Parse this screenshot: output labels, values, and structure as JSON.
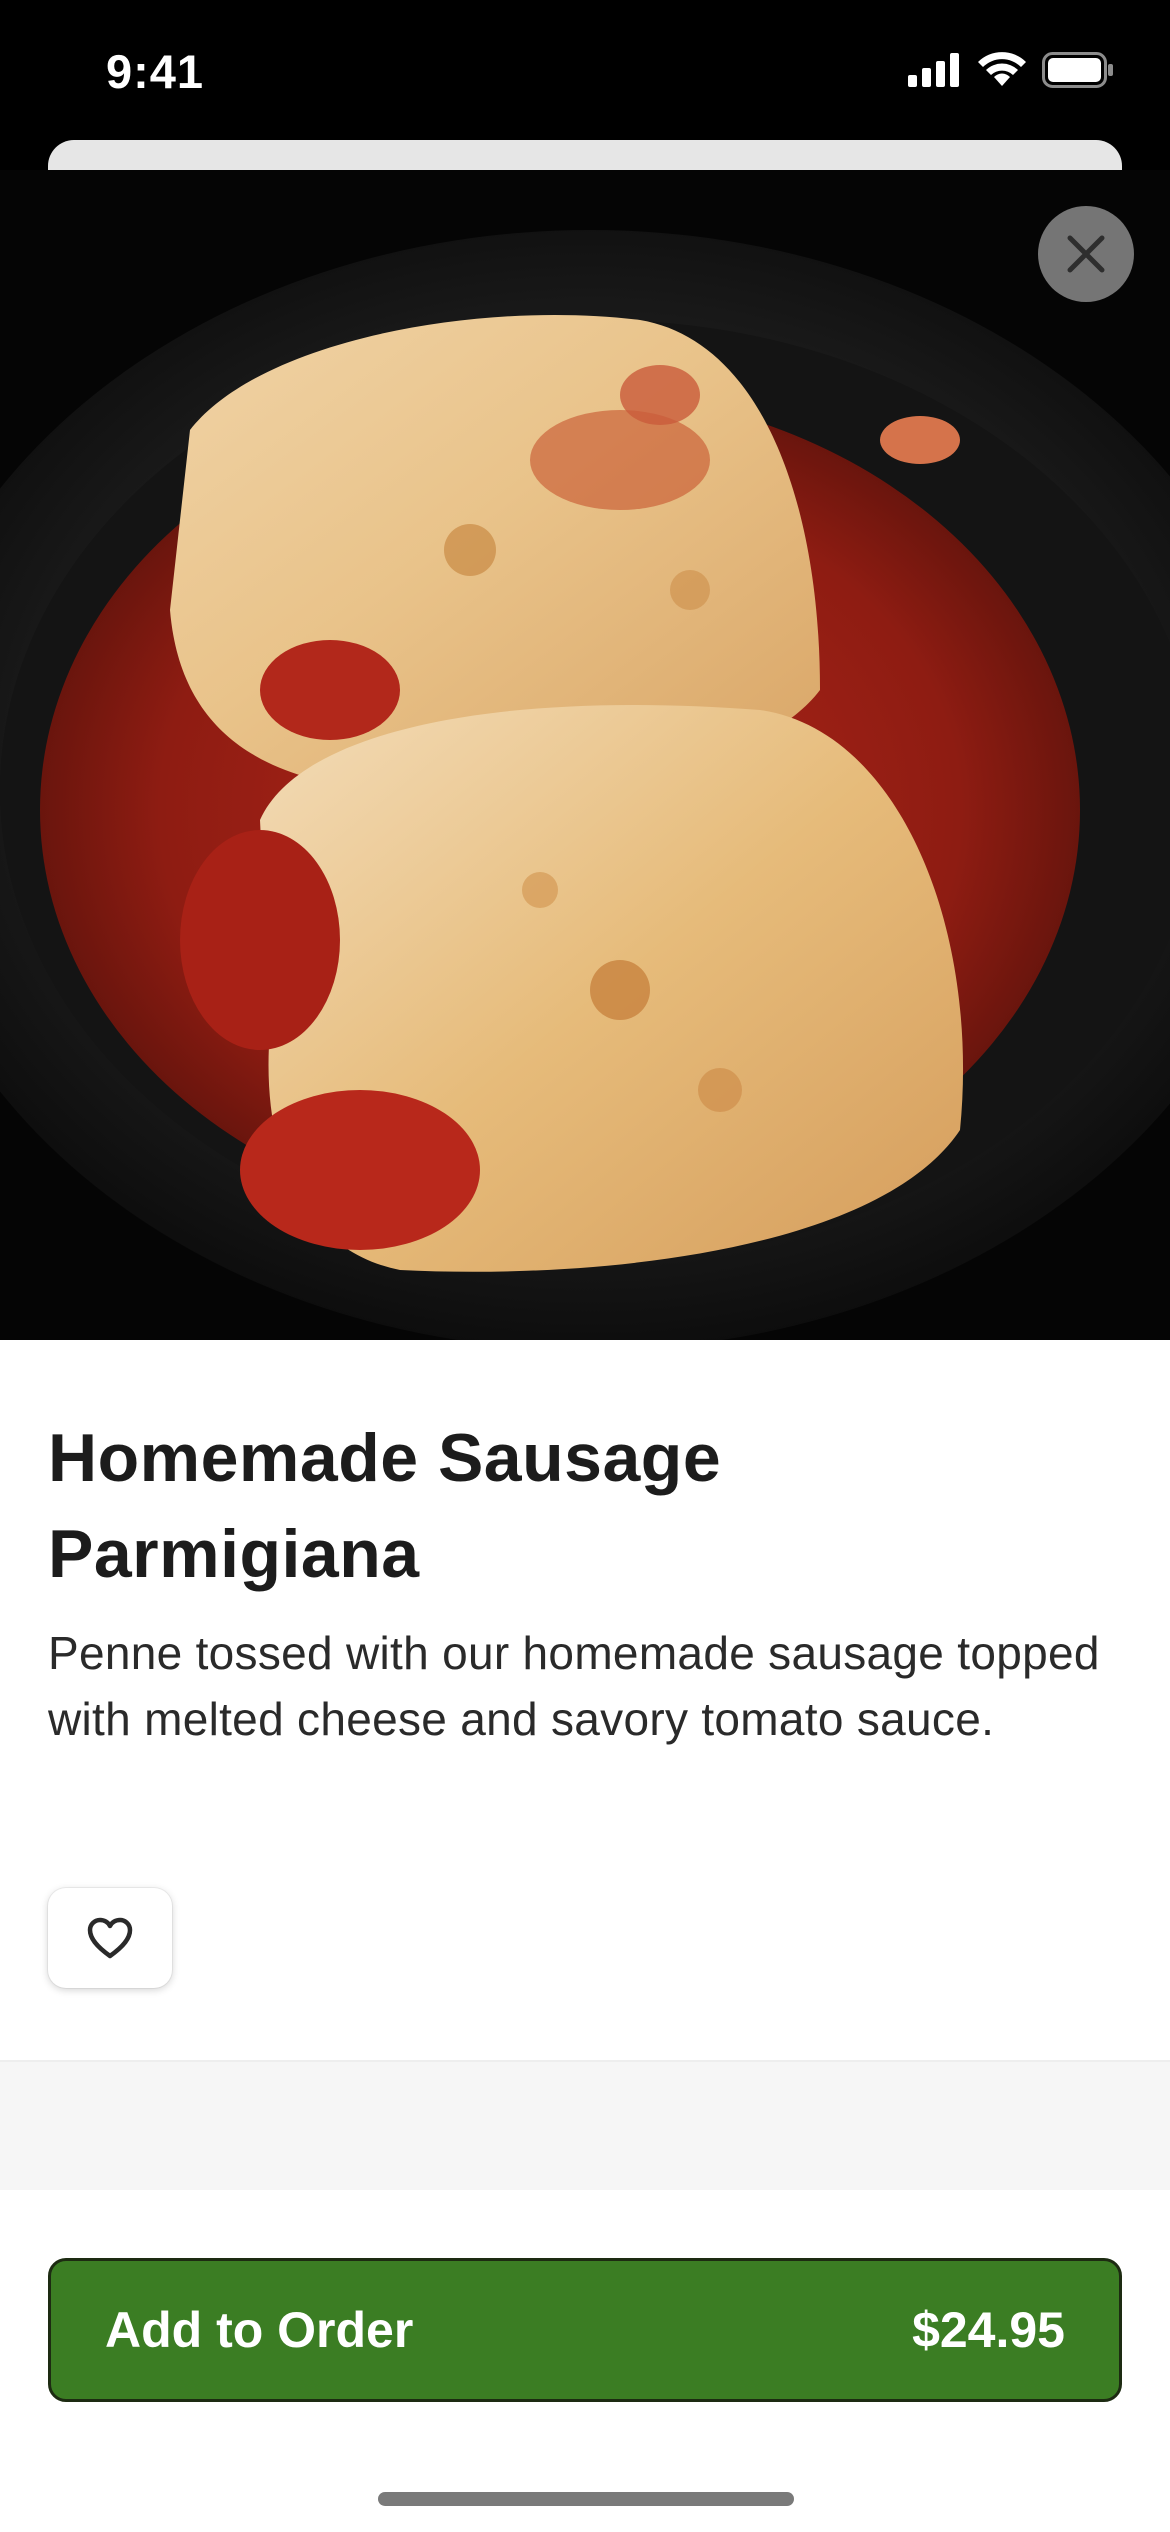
{
  "status_bar": {
    "time": "9:41"
  },
  "item": {
    "title_line1": "Homemade Sausage",
    "title_line2": "Parmigiana",
    "description": "Penne tossed with our homemade sausage topped with melted cheese and savory tomato sauce.",
    "image_icon": "food-photo"
  },
  "actions": {
    "close_icon": "close-icon",
    "favorite_icon": "heart-outline-icon",
    "add_to_order_label": "Add to Order",
    "price": "$24.95"
  },
  "colors": {
    "accent": "#3b7d23",
    "background": "#ffffff",
    "text": "#1c1c1c"
  }
}
